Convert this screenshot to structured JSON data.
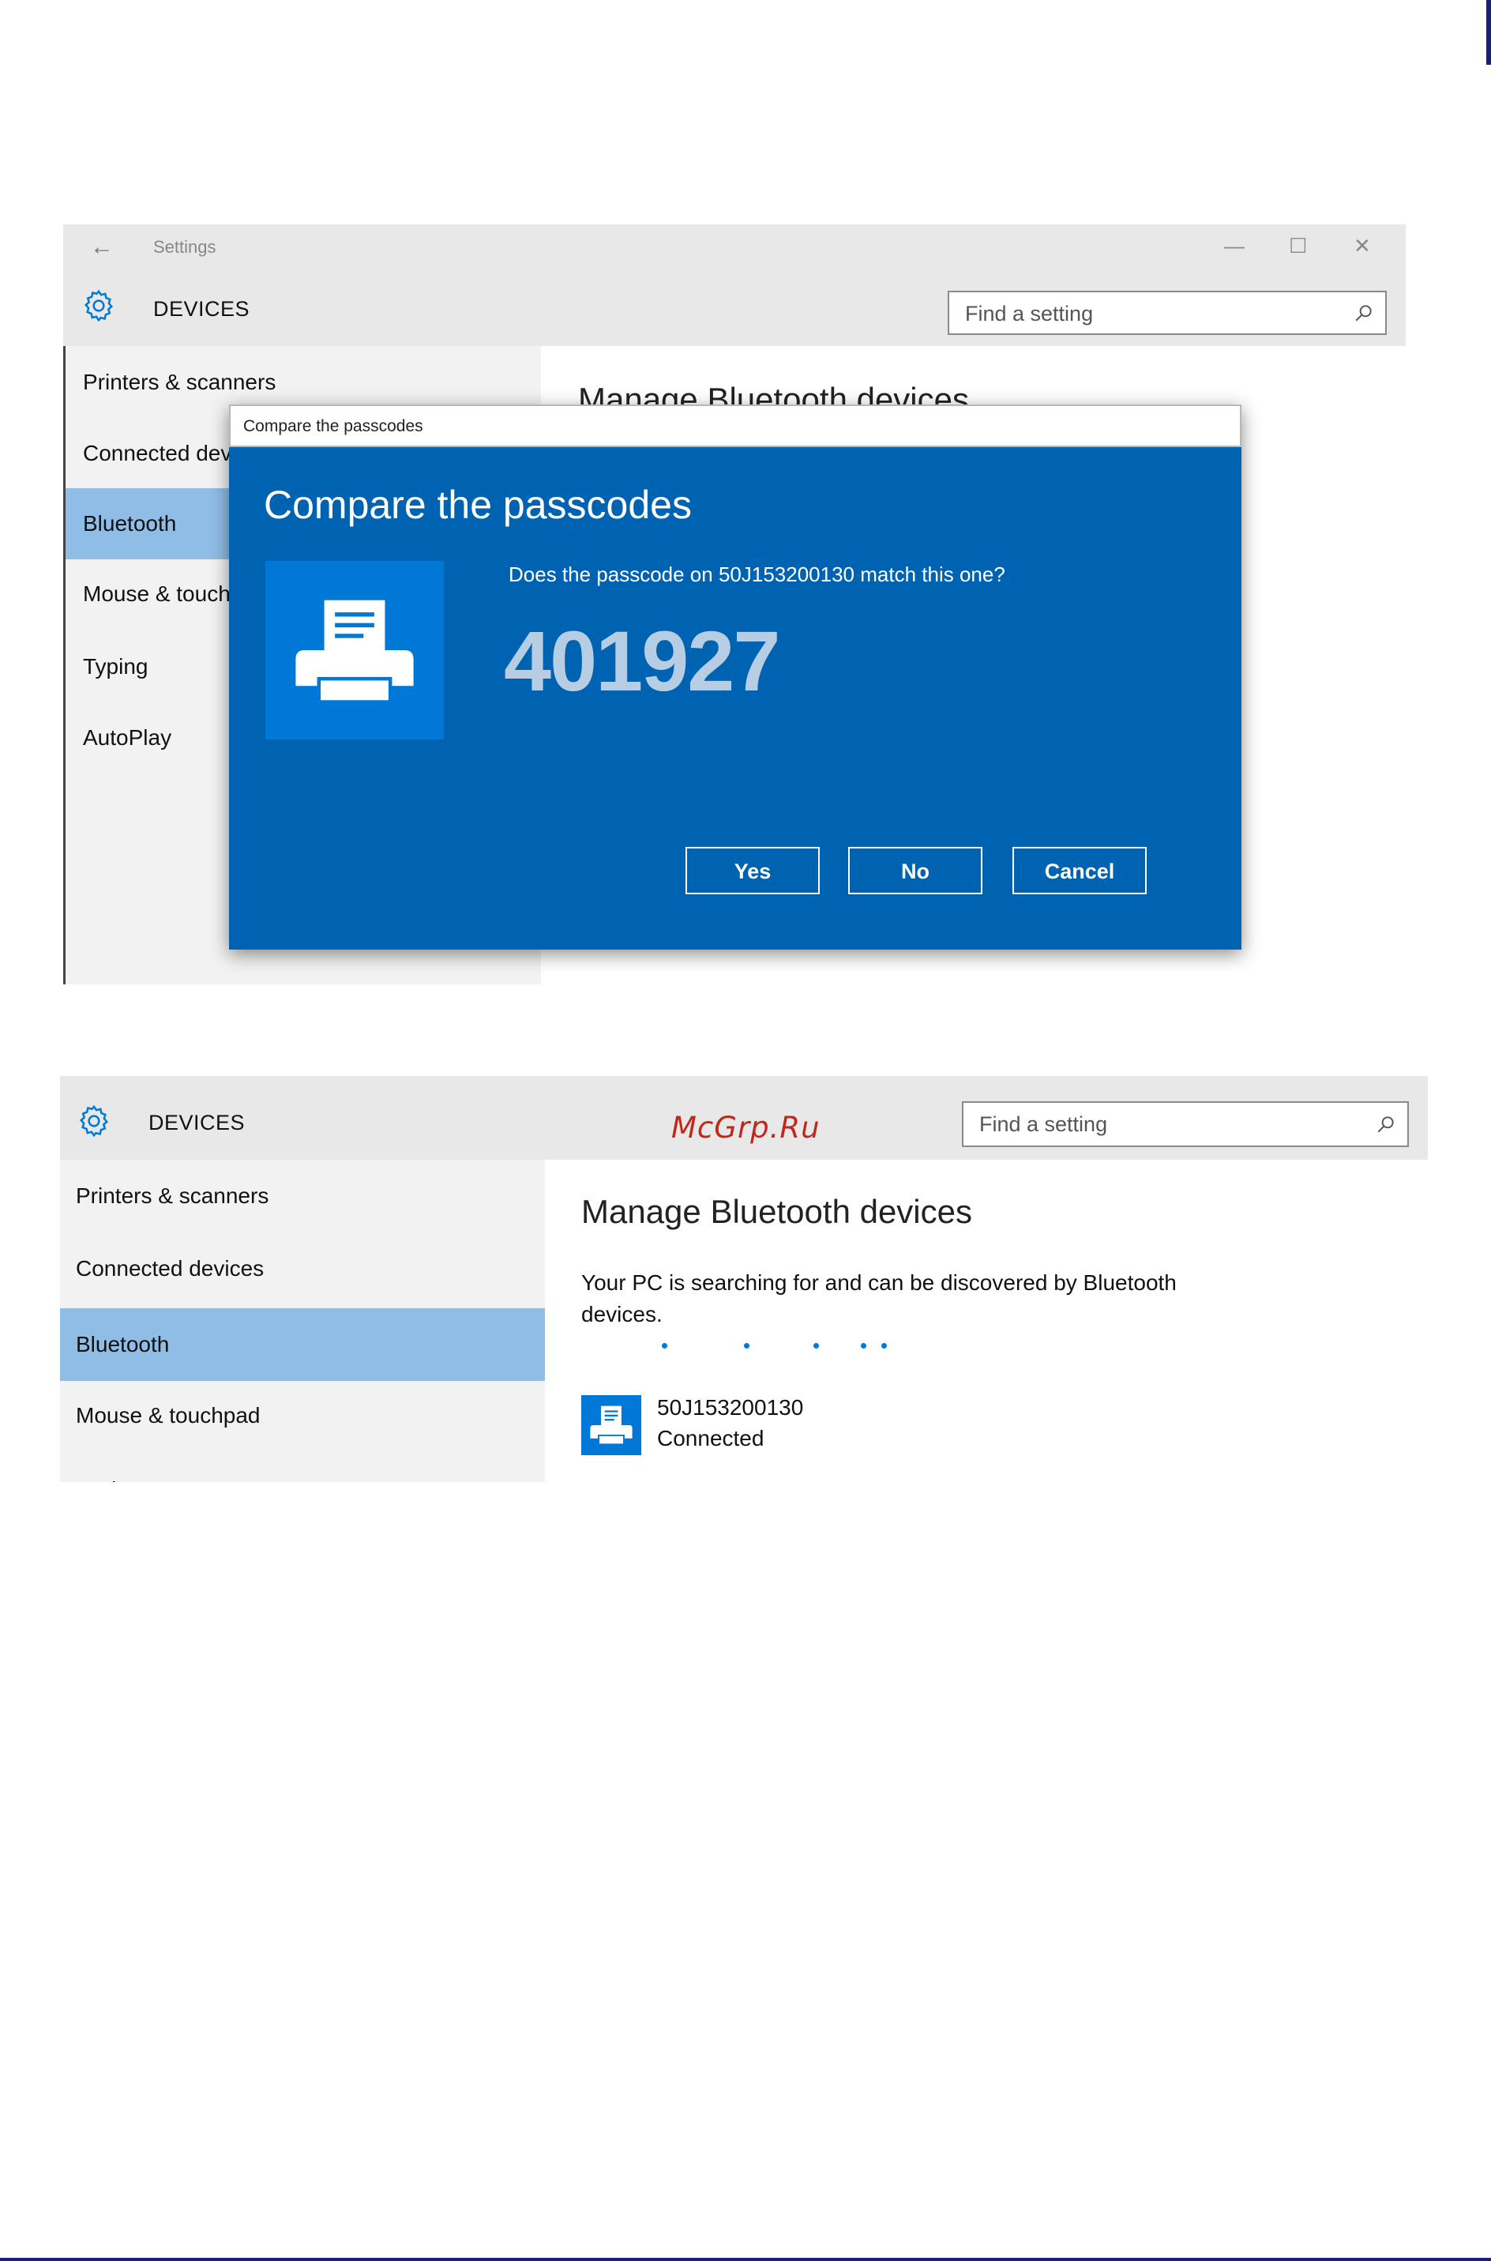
{
  "window": {
    "app_title": "Settings",
    "back_icon": "back-arrow-icon",
    "minimize_glyph": "—",
    "maximize_glyph": "☐",
    "close_glyph": "✕"
  },
  "header": {
    "section_title": "DEVICES",
    "settings_icon": "gear-icon",
    "search_placeholder": "Find a setting",
    "search_icon": "search-icon"
  },
  "sidebar": {
    "items": [
      {
        "label": "Printers & scanners"
      },
      {
        "label": "Connected devices"
      },
      {
        "label": "Bluetooth"
      },
      {
        "label": "Mouse & touchpad"
      },
      {
        "label": "Typing"
      },
      {
        "label": "AutoPlay"
      }
    ],
    "selected": "Bluetooth",
    "shot1_visible": [
      "Printers & scanners",
      "Connected dev",
      "Bluetooth",
      "Mouse & touch",
      "Typing",
      "AutoPlay"
    ]
  },
  "content": {
    "title": "Manage Bluetooth devices",
    "status": "Your PC is searching for and can be discovered by Bluetooth devices."
  },
  "dialog": {
    "bar_title": "Compare the passcodes",
    "heading": "Compare the passcodes",
    "question": "Does the passcode on 50J153200130 match this one?",
    "passcode": "401927",
    "device_icon": "printer-icon",
    "buttons": {
      "yes": "Yes",
      "no": "No",
      "cancel": "Cancel"
    }
  },
  "device": {
    "name": "50J153200130",
    "status": "Connected",
    "icon": "printer-icon"
  },
  "watermark": "McGrp.Ru",
  "colors": {
    "accent": "#0078d7",
    "dialog_bg": "#0063b1",
    "selected_nav": "#90bde6",
    "chrome": "#e8e8e8",
    "passcode": "#b6cde4",
    "watermark": "#c0281c",
    "page_rule": "#1b1f6e"
  }
}
